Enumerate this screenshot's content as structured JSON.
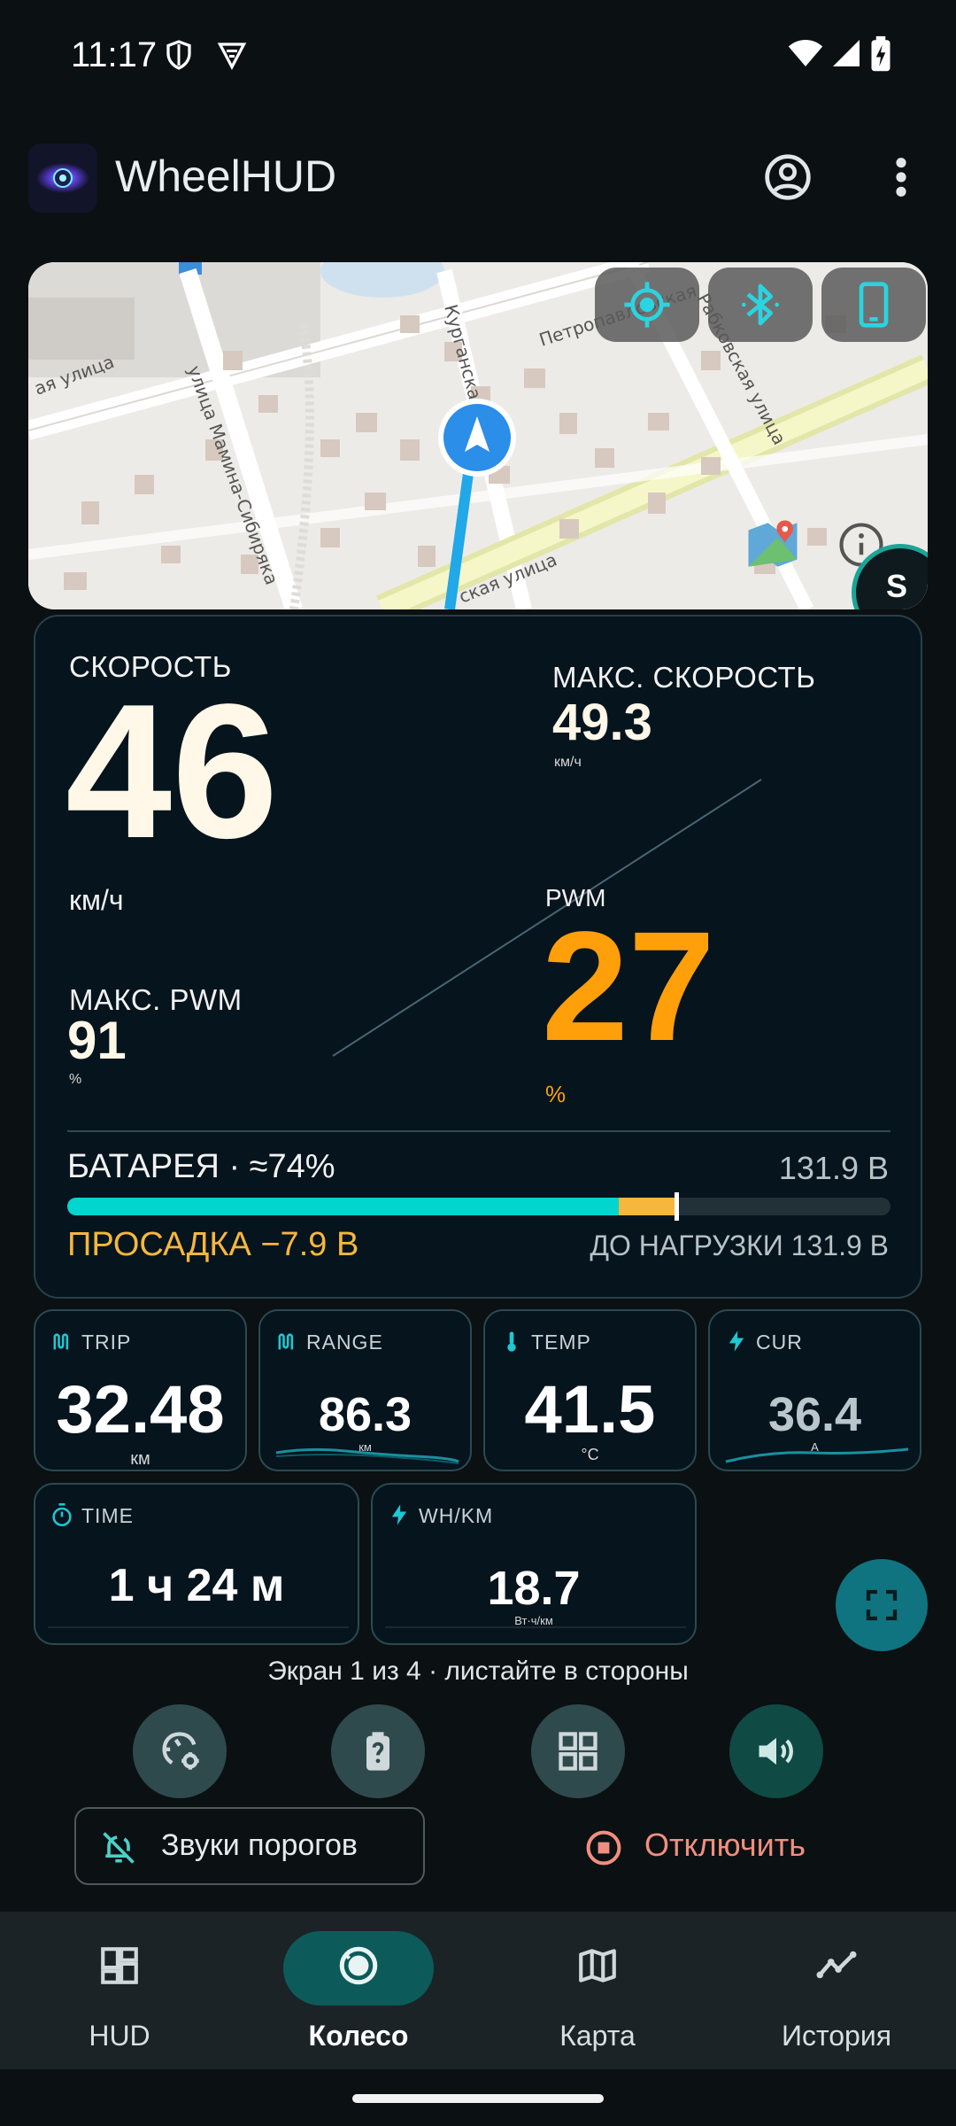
{
  "status_bar": {
    "time": "11:17"
  },
  "app_bar": {
    "title": "WheelHUD"
  },
  "map": {
    "street_labels": [
      "Петропавловская",
      "Курганская",
      "улица Мамина-Сибиряка",
      "ая улица",
      "ская улица",
      "Рабковская улица"
    ],
    "badge": "S"
  },
  "speed": {
    "label": "СКОРОСТЬ",
    "value": "46",
    "unit": "км/ч",
    "max_label": "МАКС. СКОРОСТЬ",
    "max_value": "49.3",
    "max_unit": "км/ч"
  },
  "pwm": {
    "max_label": "МАКС. PWM",
    "max_value": "91",
    "max_unit": "%",
    "label": "PWM",
    "value": "27",
    "unit": "%"
  },
  "battery": {
    "label": "БАТАРЕЯ · ≈74%",
    "voltage": "131.9 В",
    "level_fraction": 0.74,
    "sag_fraction": 0.07,
    "sag_label": "ПРОСАДКА −7.9 В",
    "no_load_label": "ДО НАГРУЗКИ 131.9 В"
  },
  "tiles": {
    "trip": {
      "label": "TRIP",
      "value": "32.48",
      "unit": "км"
    },
    "range": {
      "label": "RANGE",
      "value": "86.3",
      "unit": "км"
    },
    "temp": {
      "label": "TEMP",
      "value": "41.5",
      "unit": "°C"
    },
    "cur": {
      "label": "CUR",
      "value": "36.4",
      "unit": "A"
    },
    "time": {
      "label": "TIME",
      "value": "1 ч 24 м"
    },
    "whkm": {
      "label": "WH/KM",
      "value": "18.7",
      "unit": "Вт·ч/км"
    }
  },
  "screen_hint": "Экран 1 из 4 · листайте в стороны",
  "actions": {
    "sounds_label": "Звуки порогов",
    "disconnect_label": "Отключить"
  },
  "nav": {
    "items": [
      {
        "label": "HUD",
        "icon": "dashboard-icon"
      },
      {
        "label": "Колесо",
        "icon": "wheel-icon"
      },
      {
        "label": "Карта",
        "icon": "map-icon"
      },
      {
        "label": "История",
        "icon": "history-icon"
      }
    ],
    "active": "Колесо"
  },
  "colors": {
    "accent_teal": "#00d6cf",
    "pwm_orange": "#ff9f0a",
    "sag_yellow": "#f6b73c",
    "nav_active": "#0d5a5a"
  }
}
